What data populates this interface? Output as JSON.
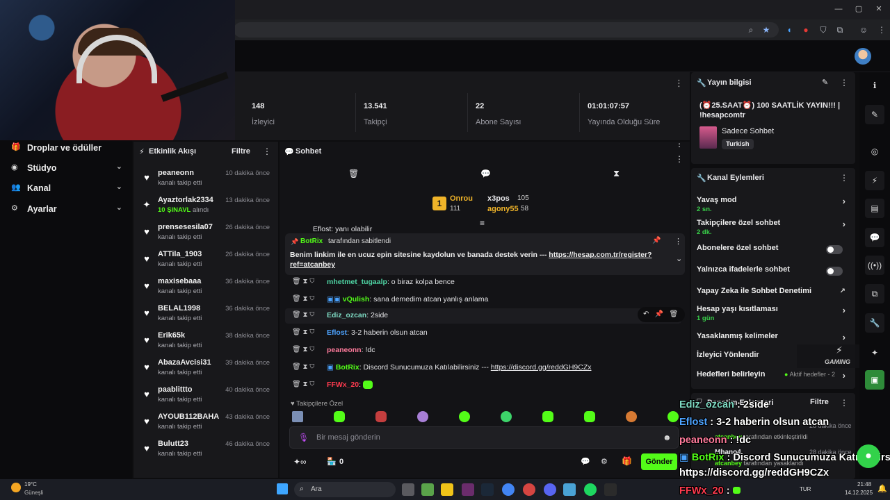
{
  "browser": {
    "window_controls": {
      "min": "—",
      "max": "▢",
      "close": "✕"
    }
  },
  "stats": [
    {
      "value": "148",
      "label": "İzleyici"
    },
    {
      "value": "13.541",
      "label": "Takipçi"
    },
    {
      "value": "22",
      "label": "Abone Sayısı"
    },
    {
      "value": "01:01:07:57",
      "label": "Yayında Olduğu Süre"
    }
  ],
  "left_nav": [
    {
      "icon": "gift-icon",
      "label": "Droplar ve ödüller",
      "has_chevron": false
    },
    {
      "icon": "camera-icon",
      "label": "Stüdyo",
      "has_chevron": true
    },
    {
      "icon": "users-icon",
      "label": "Kanal",
      "has_chevron": true
    },
    {
      "icon": "gear-icon",
      "label": "Ayarlar",
      "has_chevron": true
    }
  ],
  "activity": {
    "title": "Etkinlik Akışı",
    "filter": "Filtre",
    "items": [
      {
        "user": "peaneonn",
        "desc": "kanalı takip etti",
        "time": "10 dakika önce",
        "icon": "heart-icon"
      },
      {
        "user": "Ayaztorlak2334",
        "desc_highlight": "10 ŞINAVL",
        "desc": "alındı",
        "time": "13 dakika önce",
        "icon": "points-icon"
      },
      {
        "user": "prensesesila07",
        "desc": "kanalı takip etti",
        "time": "26 dakika önce",
        "icon": "heart-icon"
      },
      {
        "user": "ATTila_1903",
        "desc": "kanalı takip etti",
        "time": "26 dakika önce",
        "icon": "heart-icon"
      },
      {
        "user": "maxisebaaa",
        "desc": "kanalı takip etti",
        "time": "36 dakika önce",
        "icon": "heart-icon"
      },
      {
        "user": "BELAL1998",
        "desc": "kanalı takip etti",
        "time": "36 dakika önce",
        "icon": "heart-icon"
      },
      {
        "user": "Erik65k",
        "desc": "kanalı takip etti",
        "time": "38 dakika önce",
        "icon": "heart-icon"
      },
      {
        "user": "AbazaAvcisi31",
        "desc": "kanalı takip etti",
        "time": "39 dakika önce",
        "icon": "heart-icon"
      },
      {
        "user": "paablittto",
        "desc": "kanalı takip etti",
        "time": "40 dakika önce",
        "icon": "heart-icon"
      },
      {
        "user": "AYOUB112BAHA",
        "desc": "kanalı takip etti",
        "time": "43 dakika önce",
        "icon": "heart-icon"
      },
      {
        "user": "Bulutt23",
        "desc": "kanalı takip etti",
        "time": "46 dakika önce",
        "icon": "heart-icon"
      }
    ]
  },
  "chat": {
    "title": "Sohbet",
    "leaderboard": {
      "rank": "1",
      "first_name": "Onrou",
      "first_value": "111",
      "second_name": "x3pos",
      "second_value": "105",
      "third_name": "agony55",
      "third_value": "58"
    },
    "partial_line": "Eflost: yanı olabilir",
    "pinned": {
      "bot": "BotRix",
      "pinned_by": "tarafından sabitlendi",
      "message": "Benim linkim ile en ucuz epin sitesine kaydolun ve banada destek verin --- ",
      "link": "https://hesap.com.tr/register?ref=atcanbey"
    },
    "messages": [
      {
        "user": "mhetmet_tugaalp",
        "color": "#4fd6a5",
        "text": "o biraz kolpa bence"
      },
      {
        "user": "vQulish",
        "color": "#53fc18",
        "text": "sana demedim atcan yanlış anlama"
      },
      {
        "user": "Ediz_ozcan",
        "color": "#7ed9c2",
        "text": "2side"
      },
      {
        "user": "Eflost",
        "color": "#4da3ff",
        "text": "3-2 haberin olsun atcan"
      },
      {
        "user": "peaneonn",
        "color": "#ff7b9c",
        "text": "!dc"
      },
      {
        "user": "BotRix",
        "color": "#53fc18",
        "text": "Discord Sunucumuza Katılabilirsiniz --- ",
        "link": "https://discord.gg/reddGH9CZx"
      },
      {
        "user": "FFWx_20",
        "color": "#ff3b4f",
        "text": ""
      }
    ],
    "followers_only": "Takipçilere Özel",
    "input_placeholder": "Bir mesaj gönderin",
    "points_count": "0",
    "send": "Gönder"
  },
  "stream_info": {
    "title": "Yayın bilgisi",
    "stream_title": "(⏰25.SAAT⏰) 100 SAATLİK YAYIN!!! | !hesapcomtr",
    "category": "Sadece Sohbet",
    "tag": "Turkish"
  },
  "channel_actions": {
    "title": "Kanal Eylemleri",
    "rows": [
      {
        "label": "Yavaş mod",
        "sub": "2 sn.",
        "control": "arrow"
      },
      {
        "label": "Takipçilere özel sohbet",
        "sub": "2 dk.",
        "control": "arrow"
      },
      {
        "label": "Abonelere özel sohbet",
        "sub": "",
        "control": "toggle"
      },
      {
        "label": "Yalnızca ifadelerle sohbet",
        "sub": "",
        "control": "toggle"
      },
      {
        "label": "Yapay Zeka ile Sohbet Denetimi",
        "sub": "",
        "control": "external"
      },
      {
        "label": "Hesap yaşı kısıtlaması",
        "sub": "1 gün",
        "control": "arrow"
      },
      {
        "label": "Yasaklanmış kelimeler",
        "sub": "",
        "control": "arrow"
      },
      {
        "label": "İzleyici Yönlendir",
        "sub": "",
        "control": "none"
      },
      {
        "label": "Hedefleri belirleyin",
        "sub": "",
        "control": "arrow",
        "badge": "Aktif hedefler - 2"
      }
    ]
  },
  "moderation": {
    "title": "Denetim Eylemleri",
    "filter": "Filtre",
    "item1_time": "28 dakika önce",
    "item1_by": "atcanbey",
    "item1_desc": "tarafından etkinleştirildi",
    "item2_user": "Mhano4",
    "item2_time": "28 dakika önce",
    "item2_by": "atcanbey",
    "item2_desc": "tarafından yasaklandı"
  },
  "overlay": {
    "lines": [
      {
        "user": "Ediz_ozcan",
        "sep": " : ",
        "text": "2side",
        "color": "#7ed9c2"
      },
      {
        "user": "Eflost",
        "sep": " : ",
        "text": "3-2 haberin olsun atcan",
        "color": "#4da3ff"
      },
      {
        "user": "peaneonn",
        "sep": " : ",
        "text": "!dc",
        "color": "#ff7b9c"
      },
      {
        "user": "BotRix",
        "sep": " : ",
        "text": "Discord Sunucumuza Katılabilirs",
        "color": "#53fc18"
      },
      {
        "user": "",
        "sep": "",
        "text": "https://discord.gg/reddGH9CZx",
        "color": "#ffffff"
      },
      {
        "user": "FFWx_20",
        "sep": " : ",
        "text": "",
        "color": "#ff3b4f"
      }
    ],
    "logo_text": "GAMING"
  },
  "taskbar": {
    "weather_temp": "19°C",
    "weather_desc": "Güneşli",
    "search": "Ara",
    "lang": "TUR",
    "time": "21:48",
    "date": "14.12.2025"
  },
  "colors": {
    "accent": "#53fc18",
    "panel": "#18181b",
    "bg": "#0d0d0f"
  }
}
